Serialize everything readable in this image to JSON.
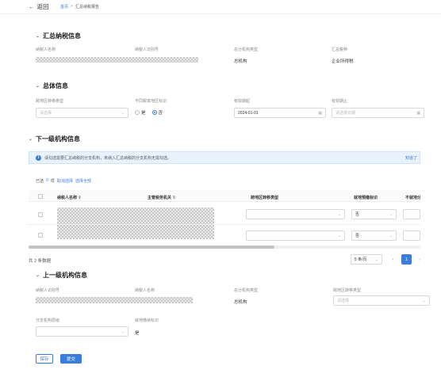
{
  "header": {
    "back_label": "返回",
    "breadcrumb": {
      "home": "首页",
      "sep": ">",
      "current": "汇总纳税报告"
    }
  },
  "summary_section": {
    "title": "汇总纳税信息",
    "fields": [
      {
        "label": "纳税人名称",
        "value": ""
      },
      {
        "label": "纳税人识别号",
        "value": ""
      },
      {
        "label": "总分机构类型",
        "value": "总机构"
      },
      {
        "label": "汇总税种",
        "value": "企业所得税"
      }
    ]
  },
  "overall_section": {
    "title": "总体信息",
    "cross_region": {
      "label": "跨地区转移类型",
      "placeholder": "请选择"
    },
    "same_region": {
      "label": "不同税率地区标识",
      "options": [
        "是",
        "否"
      ],
      "selected": "否"
    },
    "valid_from": {
      "label": "有效期起",
      "value": "2024-01-01"
    },
    "valid_to": {
      "label": "有效期止",
      "placeholder": "请选择日期"
    }
  },
  "subordinate_section": {
    "title": "下一级机构信息",
    "notice": "请勾选需要汇总纳税的分支机构，未纳入汇总纳税的分支机构无需勾选。",
    "notice_link": "知道了",
    "selected_prefix": "已选",
    "selected_count": "0",
    "selected_suffix": "项",
    "cancel_select": "取消选择",
    "select_all": "选择全部",
    "columns": [
      "纳税人名称",
      "主管税务机关",
      "跨地区转移类型",
      "就地预缴标识",
      "不就地分"
    ],
    "rows": [
      {
        "name": "",
        "tax_office": "",
        "cross_region": "",
        "prepay": "否",
        "extra": ""
      },
      {
        "name": "",
        "tax_office": "",
        "cross_region": "",
        "prepay": "否",
        "extra": ""
      }
    ],
    "pagination": {
      "total": "共 2 条数据",
      "page_size": "5 条/页",
      "current": "1",
      "prev": "‹",
      "next": "›"
    }
  },
  "superior_section": {
    "title": "上一级机构信息",
    "fields": [
      {
        "label": "纳税人识别号",
        "value": ""
      },
      {
        "label": "纳税人名称",
        "value": ""
      },
      {
        "label": "总分机构类型",
        "value": "总机构"
      }
    ],
    "cross_region": {
      "label": "跨地区转移类型",
      "placeholder": "请选择"
    },
    "branch_level": {
      "label": "分支机构层级",
      "placeholder": ""
    },
    "local_prepay": {
      "label": "就地缴纳标识",
      "value": "是"
    }
  },
  "actions": {
    "save": "保存",
    "submit": "提交"
  },
  "colors": {
    "accent": "#3b7ddd",
    "info_bg": "#e8f2fd"
  }
}
